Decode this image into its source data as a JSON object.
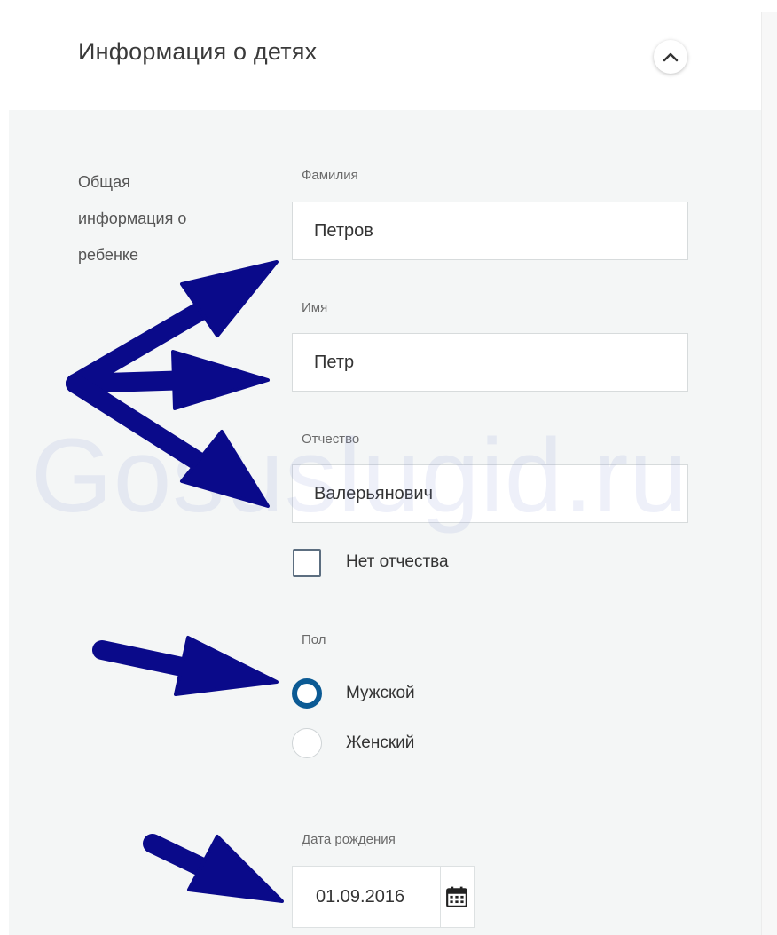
{
  "header": {
    "title": "Информация о детях",
    "collapse_icon": "chevron-up-icon"
  },
  "section": {
    "label": "Общая информация о ребенке"
  },
  "fields": {
    "surname": {
      "label": "Фамилия",
      "value": "Петров"
    },
    "name": {
      "label": "Имя",
      "value": "Петр"
    },
    "patronymic": {
      "label": "Отчество",
      "value": "Валерьянович"
    }
  },
  "no_patronymic": {
    "label": "Нет отчества",
    "checked": false
  },
  "gender": {
    "label": "Пол",
    "options": [
      {
        "label": "Мужской",
        "checked": true
      },
      {
        "label": "Женский",
        "checked": false
      }
    ]
  },
  "birth_date": {
    "label": "Дата рождения",
    "value": "01.09.2016",
    "icon": "calendar-icon"
  },
  "watermark": "Gosuslugid.ru",
  "colors": {
    "accent": "#0b5a94",
    "arrow": "#0a0a8a",
    "panel_background": "#f4f6f6"
  }
}
